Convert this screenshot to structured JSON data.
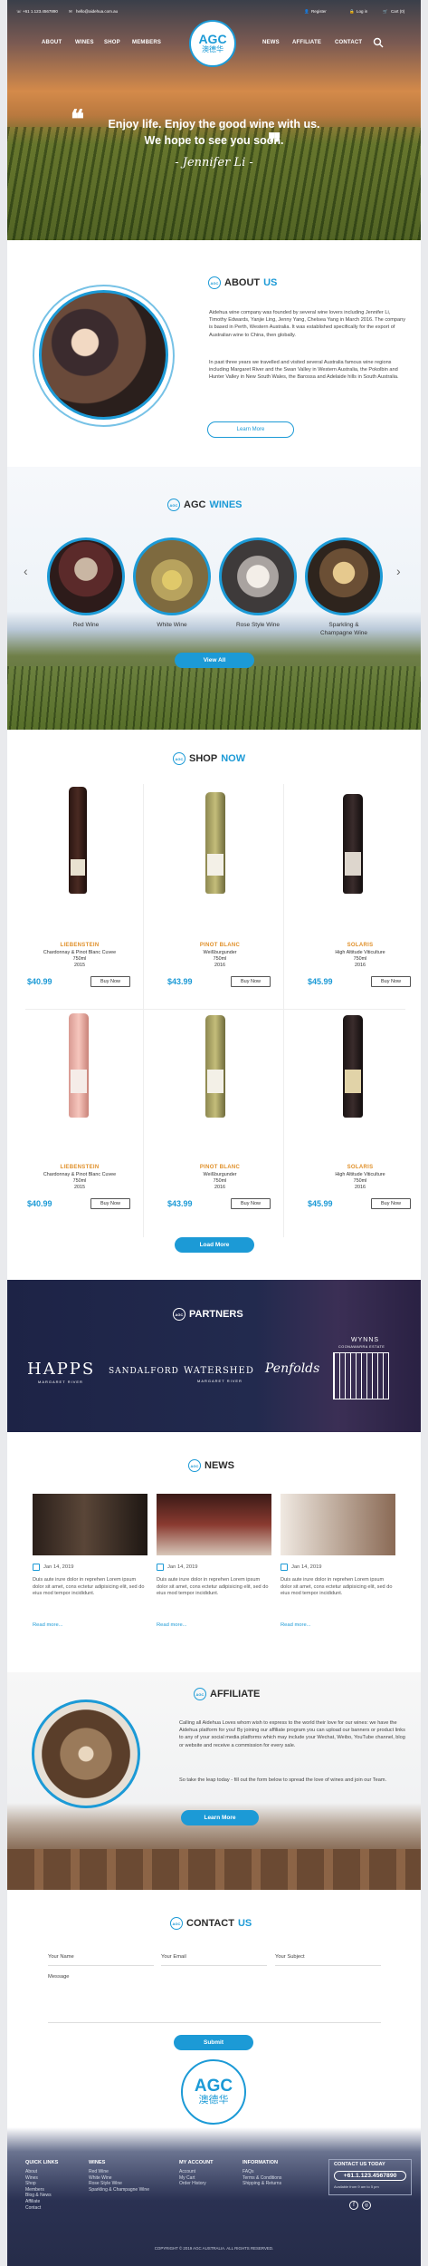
{
  "topbar": {
    "phone": "+61 1.123.4567890",
    "email": "hello@aidehua.com.au",
    "register": "Register",
    "login": "Log in",
    "cart": "Cart (0)"
  },
  "nav": {
    "left": [
      "ABOUT",
      "WINES",
      "SHOP",
      "MEMBERS"
    ],
    "right": [
      "NEWS",
      "AFFILIATE",
      "CONTACT"
    ]
  },
  "logo": {
    "text": "AGC",
    "chinese": "澳德华"
  },
  "hero": {
    "line1": "Enjoy life. Enjoy the good wine with us.",
    "line2": "We hope to see you soon.",
    "signature": "- Jennifer Li -"
  },
  "about": {
    "title_a": "ABOUT",
    "title_b": "US",
    "p1": "Aidehua wine company was founded by several wine lovers including Jennifer Li, Timothy Edwards, Yanjie Ling, Jenny Yang, Chelsea Yang in March 2016. The company is based in Perth, Western Australia. It was established specifically for the export of Australian wine to China, then globally.",
    "p2": "In past three years we travelled and visited several Australia famous wine regions including Margaret River and the Swan Valley in Western Australia, the Pokolbin and Hunter Valley in New South Wales, the Barossa and Adelaide hills in South Australia.",
    "button": "Learn More"
  },
  "wines": {
    "title_a": "AGC",
    "title_b": "WINES",
    "categories": [
      "Red Wine",
      "White Wine",
      "Rose Style Wine",
      "Sparkling &",
      "Champagne Wine"
    ],
    "button": "View All",
    "prev_arrow": "‹",
    "next_arrow": "›"
  },
  "shop": {
    "title_a": "SHOP",
    "title_b": "NOW",
    "products": [
      {
        "brand": "LIEBENSTEIN",
        "name": "Chardonnay & Pinot Blanc Cuvee",
        "size": "750ml",
        "year": "2015",
        "price": "$40.99",
        "buy": "Buy Now",
        "brand_color": "#e0902a"
      },
      {
        "brand": "PINOT BLANC",
        "name": "Weißburgunder",
        "size": "750ml",
        "year": "2016",
        "price": "$43.99",
        "buy": "Buy Now",
        "brand_color": "#e0902a"
      },
      {
        "brand": "SOLARIS",
        "name": "High Altitude Viticulture",
        "size": "750ml",
        "year": "2016",
        "price": "$45.99",
        "buy": "Buy Now",
        "brand_color": "#e0902a"
      },
      {
        "brand": "LIEBENSTEIN",
        "name": "Chardonnay & Pinot Blanc Cuvee",
        "size": "750ml",
        "year": "2015",
        "price": "$40.99",
        "buy": "Buy Now",
        "brand_color": "#e0902a"
      },
      {
        "brand": "PINOT BLANC",
        "name": "Weißburgunder",
        "size": "750ml",
        "year": "2016",
        "price": "$43.99",
        "buy": "Buy Now",
        "brand_color": "#e0902a"
      },
      {
        "brand": "SOLARIS",
        "name": "High Altitude Viticulture",
        "size": "750ml",
        "year": "2016",
        "price": "$45.99",
        "buy": "Buy Now",
        "brand_color": "#e0902a"
      }
    ],
    "button": "Load More"
  },
  "partners": {
    "title": "PARTNERS",
    "happs": "HAPPS",
    "happs_sub": "MARGARET RIVER",
    "sandalford": "SANDALFORD",
    "watershed": "WATERSHED",
    "watershed_sub": "MARGARET RIVER",
    "penfolds": "Penfolds",
    "wynns": "WYNNS",
    "wynns_sub": "COONAWARRA ESTATE"
  },
  "news": {
    "title": "NEWS",
    "items": [
      {
        "date": "Jan 14, 2019",
        "text": "Duis aute irure dolor in reprehen Lorem ipsum dolor sit amet, cons ectetur adipisicing elit, sed do eius mod tempor incididunt.",
        "more": "Read more..."
      },
      {
        "date": "Jan 14, 2019",
        "text": "Duis aute irure dolor in reprehen Lorem ipsum dolor sit amet, cons ectetur adipisicing elit, sed do eius mod tempor incididunt.",
        "more": "Read more..."
      },
      {
        "date": "Jan 14, 2019",
        "text": "Duis aute irure dolor in reprehen Lorem ipsum dolor sit amet, cons ectetur adipisicing elit, sed do eius mod tempor incididunt.",
        "more": "Read more..."
      }
    ]
  },
  "affiliate": {
    "title": "AFFILIATE",
    "p1": "Calling all Aidehua Loves whom wish to express to the world their love for our wines: we have the Aidehua platform for you! By joining our affiliate program you can upload our banners or product links to any of your social media platforms which may include your Wechat, Weibo, YouTube channel, blog or website and receive a commission for every sale.",
    "p2": "So take the leap today - fill out the form below to spread the love of wines and join our Team.",
    "button": "Learn More"
  },
  "contact": {
    "title_a": "CONTACT",
    "title_b": "US",
    "name": "Your Name",
    "email": "Your Email",
    "subject": "Your Subject",
    "message": "Message",
    "submit": "Submit"
  },
  "footer": {
    "quick": {
      "title": "QUICK LINKS",
      "items": [
        "About",
        "Wines",
        "Shop",
        "Members",
        "Blog & News",
        "Affiliate",
        "Contact"
      ]
    },
    "wines": {
      "title": "WINES",
      "items": [
        "Red Wine",
        "White Wine",
        "Rose Style Wine",
        "Sparkling & Champagne Wine"
      ]
    },
    "account": {
      "title": "MY ACCOUNT",
      "items": [
        "Account",
        "My Cart",
        "Order History"
      ]
    },
    "info": {
      "title": "INFORMATION",
      "items": [
        "FAQs",
        "Terms & Conditions",
        "Shipping & Returns"
      ]
    },
    "contact": {
      "title": "CONTACT US TODAY",
      "phone": "+61.1.123.4567890",
      "hours": "Available from 9 am to 5 pm"
    },
    "copyright": "COPYRIGHT © 2019 AGC AUSTRALIA. ALL RIGHTS RESERVED."
  },
  "colors": {
    "accent": "#1c9ad6",
    "brand_gold": "#e0902a",
    "partners_bg": "#1d2346",
    "footer_bg": "#2a3152"
  }
}
